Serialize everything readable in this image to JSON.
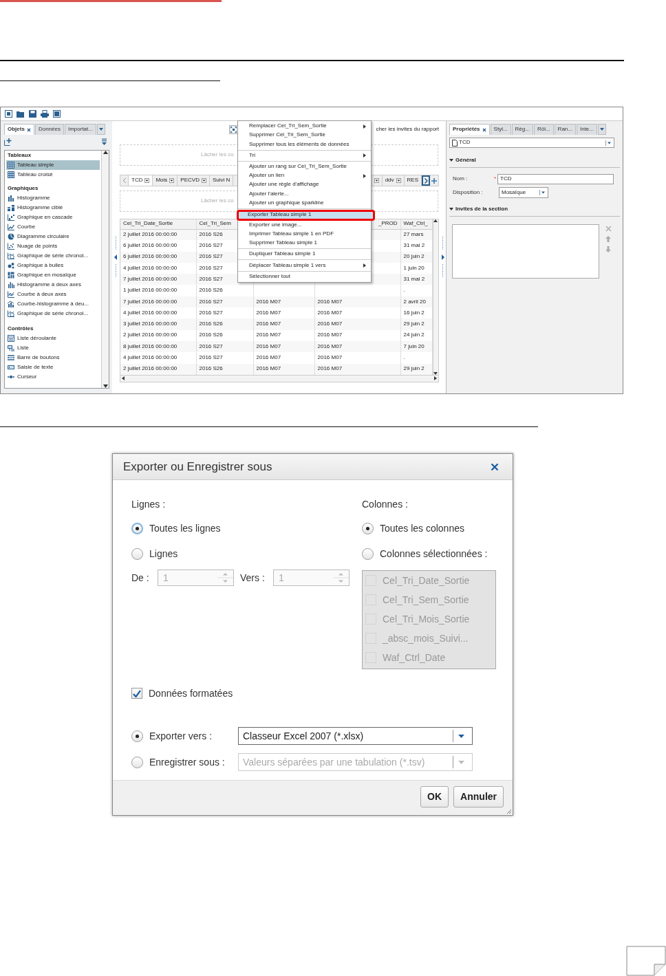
{
  "report_window": {
    "left_panel": {
      "tabs": [
        {
          "label": "Objets",
          "selected": true,
          "closable": true
        },
        {
          "label": "Données",
          "selected": false,
          "closable": false
        },
        {
          "label": "Importat...",
          "selected": false,
          "closable": false
        }
      ],
      "sections": [
        {
          "title": "Tableaux",
          "items": [
            {
              "label": "Tableau simple",
              "selected": true
            },
            {
              "label": "Tableau croisé",
              "selected": false
            }
          ]
        },
        {
          "title": "Graphiques",
          "items": [
            {
              "label": "Histogramme",
              "selected": false
            },
            {
              "label": "Histogramme ciblé",
              "selected": false
            },
            {
              "label": "Graphique en cascade",
              "selected": false
            },
            {
              "label": "Courbe",
              "selected": false
            },
            {
              "label": "Diagramme circulaire",
              "selected": false
            },
            {
              "label": "Nuage de points",
              "selected": false
            },
            {
              "label": "Graphique de série chronol...",
              "selected": false
            },
            {
              "label": "Graphique à bulles",
              "selected": false
            },
            {
              "label": "Graphique en mosaïque",
              "selected": false
            },
            {
              "label": "Histogramme à deux axes",
              "selected": false
            },
            {
              "label": "Courbe à deux axes",
              "selected": false
            },
            {
              "label": "Courbe-histogramme à deu...",
              "selected": false
            },
            {
              "label": "Graphique de série chronol...",
              "selected": false
            }
          ]
        },
        {
          "title": "Contrôles",
          "items": [
            {
              "label": "Liste déroulante",
              "selected": false
            },
            {
              "label": "Liste",
              "selected": false
            },
            {
              "label": "Barre de boutons",
              "selected": false
            },
            {
              "label": "Saisie de texte",
              "selected": false
            },
            {
              "label": "Curseur",
              "selected": false
            }
          ]
        }
      ]
    },
    "center": {
      "prompt_link": "cher les invites du rapport",
      "drop_zones": [
        {
          "text": "Lâcher les co"
        },
        {
          "text": "Lâcher les co"
        }
      ],
      "section_tabs": [
        {
          "kind": "tab",
          "label": "TCD",
          "selected": true,
          "dropdown": true
        },
        {
          "kind": "tab",
          "label": "Mois",
          "selected": false,
          "dropdown": true
        },
        {
          "kind": "tab",
          "label": "PECVD",
          "selected": false,
          "dropdown": true
        },
        {
          "kind": "tab",
          "label": "Suivi N",
          "selected": false,
          "dropdown": false
        },
        {
          "kind": "arrow_only",
          "selected": false,
          "dropdown": true
        },
        {
          "kind": "tab",
          "label": "ddv",
          "selected": false,
          "dropdown": true
        },
        {
          "kind": "tab",
          "label": "RES",
          "selected": false,
          "dropdown": false
        }
      ],
      "table": {
        "columns": {
          "column_1": "Cel_Tri_Date_Sortie",
          "column_2": "Cel_Tri_Sem",
          "column_4": "_PROD",
          "column_5": "Waf_Ctrl_"
        },
        "rows": [
          {
            "column_1": "2 juillet 2016 00:00:00",
            "column_2": "2016 S26",
            "column_5": "27 mars"
          },
          {
            "column_1": "6 juillet 2016 00:00:00",
            "column_2": "2016 S27",
            "column_5": "31 mai 2"
          },
          {
            "column_1": "6 juillet 2016 00:00:00",
            "column_2": "2016 S27",
            "column_5": "20 juin 2"
          },
          {
            "column_1": "4 juillet 2016 00:00:00",
            "column_2": "2016 S27",
            "column_5": "1 juin 20"
          },
          {
            "column_1": "7 juillet 2016 00:00:00",
            "column_2": "2016 S27",
            "column_5": "31 mai 2"
          },
          {
            "column_1": "1 juillet 2016 00:00:00",
            "column_2": "2016 S26",
            "column_5": "."
          },
          {
            "column_1": "7 juillet 2016 00:00:00",
            "column_2": "2016 S27",
            "column_3": "2016 M07",
            "column_4": "2016 M07",
            "column_5": "2 avril 20"
          },
          {
            "column_1": "4 juillet 2016 00:00:00",
            "column_2": "2016 S27",
            "column_3": "2016 M07",
            "column_4": "2016 M07",
            "column_5": "16 juin 2"
          },
          {
            "column_1": "3 juillet 2016 00:00:00",
            "column_2": "2016 S26",
            "column_3": "2016 M07",
            "column_4": "2016 M07",
            "column_5": "29 juin 2"
          },
          {
            "column_1": "2 juillet 2016 00:00:00",
            "column_2": "2016 S26",
            "column_3": "2016 M07",
            "column_4": "2016 M07",
            "column_5": "24 juin 2"
          },
          {
            "column_1": "8 juillet 2016 00:00:00",
            "column_2": "2016 S27",
            "column_3": "2016 M07",
            "column_4": "2016 M07",
            "column_5": "7 juin 20"
          },
          {
            "column_1": "4 juillet 2016 00:00:00",
            "column_2": "2016 S27",
            "column_3": "2016 M07",
            "column_4": "2016 M07",
            "column_5": "."
          },
          {
            "column_1": "2 juillet 2016 00:00:00",
            "column_2": "2016 S26",
            "column_3": "2016 M07",
            "column_4": "2016 M07",
            "column_5": "29 juin 2"
          }
        ]
      },
      "context_menu": {
        "groups": [
          [
            {
              "label": "Remplacer Cel_Tri_Sem_Sortie",
              "submenu": true,
              "selected": false
            },
            {
              "label": "Supprimer Cel_Tri_Sem_Sortie",
              "submenu": false,
              "selected": false
            },
            {
              "label": "Supprimer tous les éléments de données",
              "submenu": false,
              "selected": false
            }
          ],
          [
            {
              "label": "Tri",
              "submenu": true,
              "selected": false
            }
          ],
          [
            {
              "label": "Ajouter un rang sur Cel_Tri_Sem_Sortie",
              "submenu": false,
              "selected": false
            },
            {
              "label": "Ajouter un lien",
              "submenu": true,
              "selected": false
            },
            {
              "label": "Ajouter une règle d'affichage",
              "submenu": false,
              "selected": false
            },
            {
              "label": "Ajouter l'alerte...",
              "submenu": false,
              "selected": false
            },
            {
              "label": "Ajouter un graphique sparkline",
              "submenu": false,
              "selected": false
            }
          ],
          [
            {
              "label": "Exporter Tableau simple 1",
              "submenu": false,
              "selected": true
            },
            {
              "label": "Exporter une image...",
              "submenu": false,
              "selected": false
            },
            {
              "label": "Imprimer Tableau simple 1 en PDF",
              "submenu": false,
              "selected": false
            },
            {
              "label": "Supprimer Tableau simple 1",
              "submenu": false,
              "selected": false
            }
          ],
          [
            {
              "label": "Dupliquer Tableau simple 1",
              "submenu": false,
              "selected": false
            }
          ],
          [
            {
              "label": "Déplacer Tableau simple 1 vers",
              "submenu": true,
              "selected": false
            }
          ],
          [
            {
              "label": "Sélectionner tout",
              "submenu": false,
              "selected": false
            }
          ]
        ]
      }
    },
    "right_panel": {
      "tabs": [
        {
          "label": "Propriétés",
          "selected": true,
          "closable": true
        },
        {
          "label": "Styl...",
          "selected": false,
          "closable": false
        },
        {
          "label": "Règ...",
          "selected": false,
          "closable": false
        },
        {
          "label": "Rôl...",
          "selected": false,
          "closable": false
        },
        {
          "label": "Ran...",
          "selected": false,
          "closable": false
        },
        {
          "label": "Inte...",
          "selected": false,
          "closable": false
        }
      ],
      "object_select": "TCD",
      "general": {
        "title": "Général",
        "expanded": true,
        "name_label": "Nom :",
        "required_mark": "*",
        "name_value": "TCD",
        "layout_label": "Disposition :",
        "layout_value": "Mosaïque"
      },
      "prompts": {
        "title": "Invites de la section",
        "expanded": true
      }
    }
  },
  "dialog": {
    "title": "Exporter ou Enregistrer sous",
    "rows": {
      "label": "Lignes :",
      "options": [
        {
          "label": "Toutes les lignes",
          "selected": true,
          "focused": true
        },
        {
          "label": "Lignes",
          "selected": false,
          "focused": false
        }
      ],
      "from": {
        "label": "De :",
        "value": "1",
        "disabled": true
      },
      "to": {
        "label": "Vers :",
        "value": "1",
        "disabled": true
      }
    },
    "columns": {
      "label": "Colonnes :",
      "options": [
        {
          "label": "Toutes les colonnes",
          "selected": true
        },
        {
          "label": "Colonnes sélectionnées :",
          "selected": false
        }
      ],
      "disabled": true,
      "items": [
        {
          "label": "Cel_Tri_Date_Sortie",
          "checked": false
        },
        {
          "label": "Cel_Tri_Sem_Sortie",
          "checked": false
        },
        {
          "label": "Cel_Tri_Mois_Sortie",
          "checked": false
        },
        {
          "label": "_absc_mois_Suivi...",
          "checked": false
        },
        {
          "label": "Waf_Ctrl_Date",
          "checked": false
        }
      ]
    },
    "formatted": {
      "label": "Données formatées",
      "checked": true
    },
    "output": [
      {
        "label": "Exporter vers :",
        "selected": true,
        "format": "Classeur Excel 2007 (*.xlsx)",
        "disabled": false
      },
      {
        "label": "Enregistrer sous :",
        "selected": false,
        "format": "Valeurs séparées par une tabulation (*.tsv)",
        "disabled": true
      }
    ],
    "buttons": [
      {
        "label": "OK"
      },
      {
        "label": "Annuler"
      }
    ]
  }
}
